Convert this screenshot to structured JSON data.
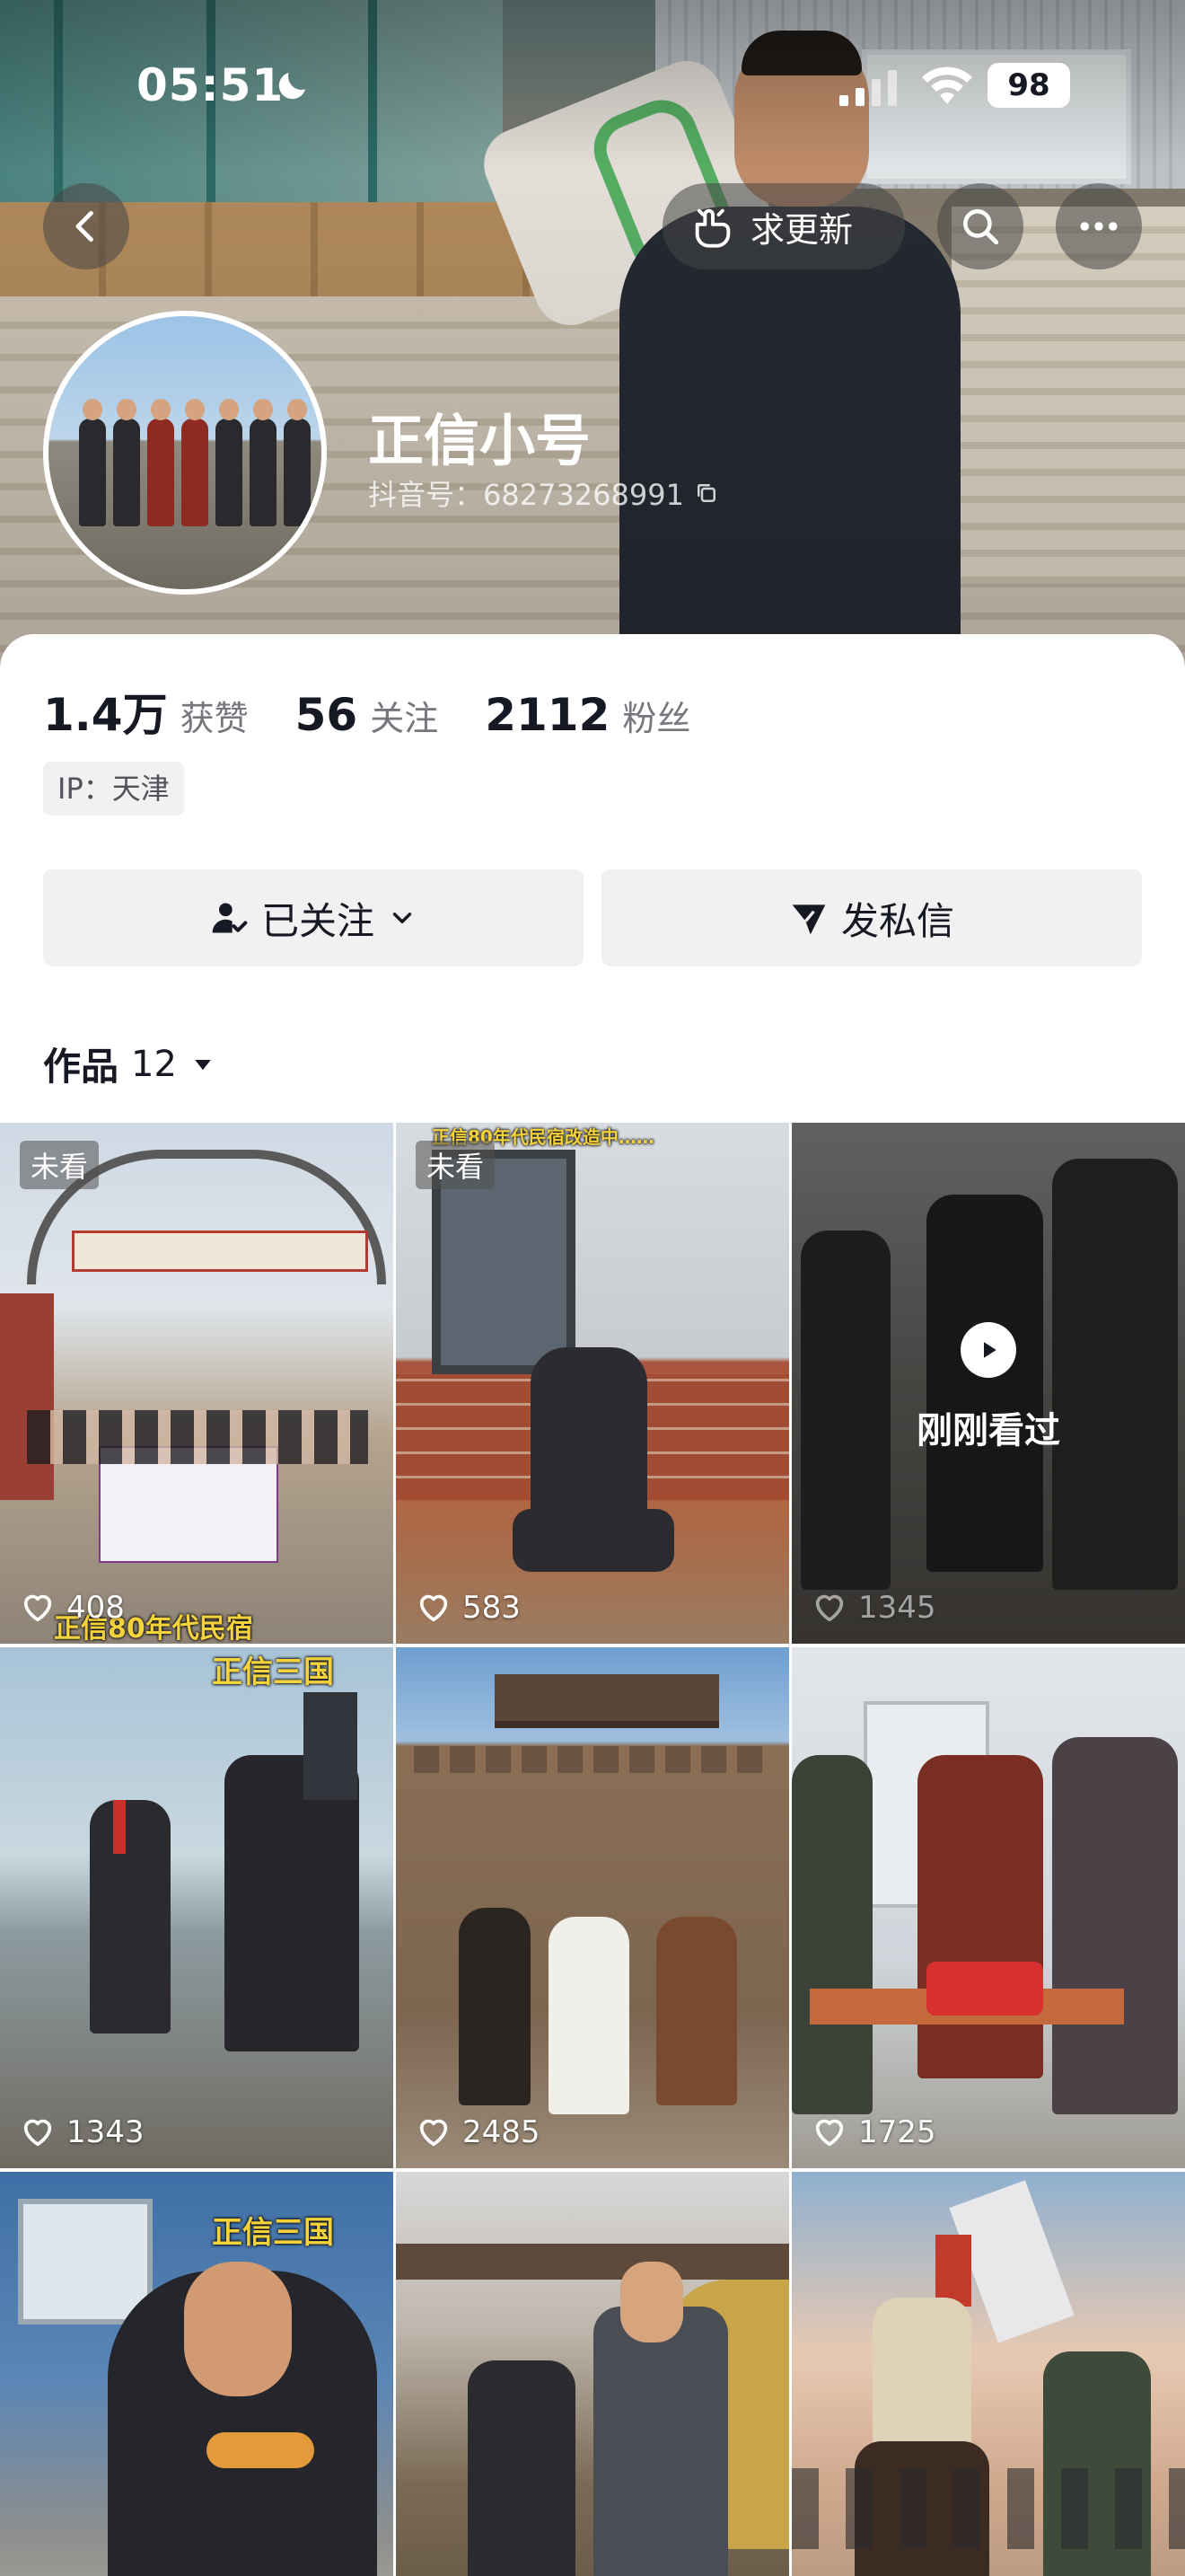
{
  "status_bar": {
    "time": "05:51",
    "battery": "98"
  },
  "header": {
    "update_button_label": "求更新",
    "nickname": "正信小号",
    "douyin_id": "抖音号：68273268991"
  },
  "stats": [
    {
      "value": "1.4万",
      "label": "获赞"
    },
    {
      "value": "56",
      "label": "关注"
    },
    {
      "value": "2112",
      "label": "粉丝"
    }
  ],
  "ip_location": "IP：天津",
  "actions": {
    "follow_label": "已关注",
    "dm_label": "发私信"
  },
  "works_tab": {
    "label": "作品",
    "count": "12"
  },
  "grid": {
    "unseen_badge": "未看",
    "recently_watched": "刚刚看过",
    "tiles": [
      {
        "likes": "408",
        "overlay": "正信80年代民宿"
      },
      {
        "likes": "583",
        "overlay": "正信80年代民宿改造中……"
      },
      {
        "likes": "1345"
      },
      {
        "likes": "1343",
        "overlay": "正信三国"
      },
      {
        "likes": "2485"
      },
      {
        "likes": "1725"
      },
      {
        "overlay": "正信三国"
      },
      {},
      {}
    ]
  },
  "icons": {
    "back": "chevron-left-icon",
    "update": "hand-point-icon",
    "search": "search-icon",
    "more": "more-dots-icon",
    "follow": "user-check-icon",
    "dropdown": "chevron-down-icon",
    "dm": "paper-plane-icon",
    "works_caret": "caret-down-icon",
    "like": "heart-outline-icon",
    "play": "play-icon"
  },
  "colors": {
    "text_primary": "#161823",
    "text_secondary": "#76777d",
    "button_bg": "#f1f1f2"
  }
}
